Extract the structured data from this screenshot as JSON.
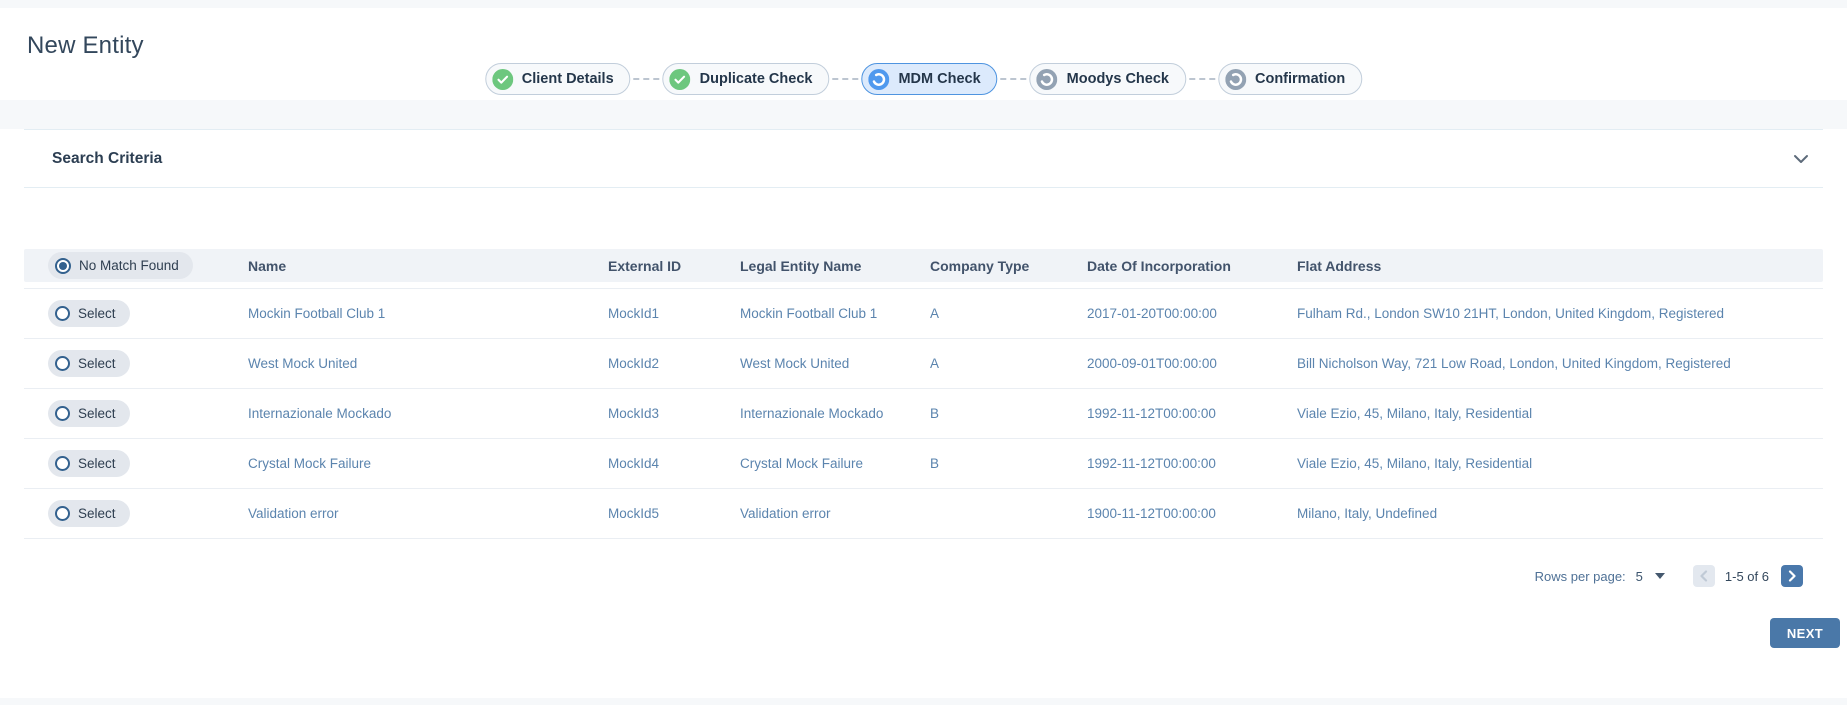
{
  "page": {
    "title": "New Entity"
  },
  "stepper": {
    "steps": [
      {
        "label": "Client Details",
        "state": "done"
      },
      {
        "label": "Duplicate Check",
        "state": "done"
      },
      {
        "label": "MDM Check",
        "state": "active"
      },
      {
        "label": "Moodys Check",
        "state": "pending"
      },
      {
        "label": "Confirmation",
        "state": "pending"
      }
    ]
  },
  "search": {
    "title": "Search Criteria"
  },
  "table": {
    "no_match_label": "No Match Found",
    "no_match_selected": true,
    "select_label": "Select",
    "columns": [
      "Name",
      "External ID",
      "Legal Entity Name",
      "Company Type",
      "Date Of Incorporation",
      "Flat Address"
    ],
    "rows": [
      {
        "name": "Mockin Football Club 1",
        "external_id": "MockId1",
        "legal_entity_name": "Mockin Football Club 1",
        "company_type": "A",
        "date_of_incorporation": "2017-01-20T00:00:00",
        "flat_address": "Fulham Rd., London SW10 21HT, London, United Kingdom, Registered"
      },
      {
        "name": "West Mock United",
        "external_id": "MockId2",
        "legal_entity_name": "West Mock United",
        "company_type": "A",
        "date_of_incorporation": "2000-09-01T00:00:00",
        "flat_address": "Bill Nicholson Way, 721 Low Road, London, United Kingdom, Registered"
      },
      {
        "name": "Internazionale Mockado",
        "external_id": "MockId3",
        "legal_entity_name": "Internazionale Mockado",
        "company_type": "B",
        "date_of_incorporation": "1992-11-12T00:00:00",
        "flat_address": "Viale Ezio, 45, Milano, Italy, Residential"
      },
      {
        "name": "Crystal Mock Failure",
        "external_id": "MockId4",
        "legal_entity_name": "Crystal Mock Failure",
        "company_type": "B",
        "date_of_incorporation": "1992-11-12T00:00:00",
        "flat_address": "Viale Ezio, 45, Milano, Italy, Residential"
      },
      {
        "name": "Validation error",
        "external_id": "MockId5",
        "legal_entity_name": "Validation error",
        "company_type": "",
        "date_of_incorporation": "1900-11-12T00:00:00",
        "flat_address": "Milano, Italy, Undefined"
      }
    ]
  },
  "pagination": {
    "rows_per_page_label": "Rows per page:",
    "rows_per_page_value": "5",
    "range_label": "1-5 of 6"
  },
  "footer": {
    "next_label": "NEXT"
  },
  "colors": {
    "step_done_green": "#6dc77e",
    "step_active_blue": "#4f99ee",
    "step_pending_gray": "#93a2b3",
    "active_pill_bg": "#dceafc",
    "active_pill_border": "#4e94e0",
    "link_text_blue": "#5b84ae",
    "primary_button_blue": "#4a78a8",
    "pager_next_blue": "#4a78ab",
    "radio_ring": "#33618e"
  }
}
